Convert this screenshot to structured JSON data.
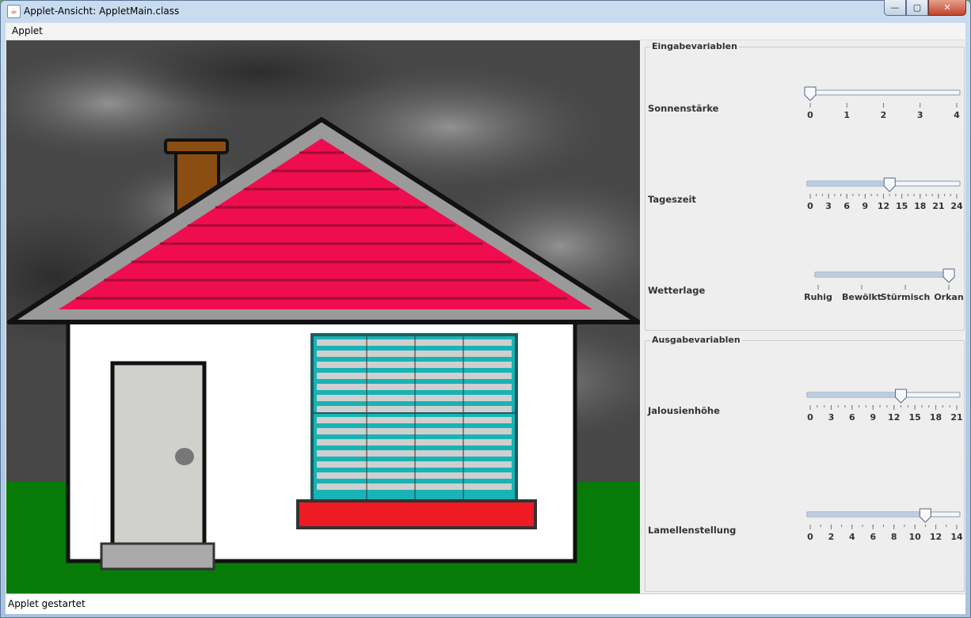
{
  "window": {
    "title": "Applet-Ansicht: AppletMain.class",
    "icon": "java-icon",
    "buttons": {
      "minimize": "—",
      "maximize": "▢",
      "close": "✕"
    }
  },
  "menu": {
    "applet": "Applet"
  },
  "scene": {
    "sky_color": "#474747",
    "grass_color": "#087a08",
    "roof_color": "#ef0d4f",
    "chimney_color": "#8b4e12",
    "wall_color": "#ffffff",
    "door_color": "#d0d0cd",
    "shutter_color": "#19b3b5",
    "sill_color": "#ee1b24"
  },
  "input_group": {
    "title": "Eingabevariablen",
    "sliders": [
      {
        "label": "Sonnenstärke",
        "min": 0,
        "max": 4,
        "value": 0,
        "major_ticks": [
          "0",
          "1",
          "2",
          "3",
          "4"
        ],
        "minor_count": 0
      },
      {
        "label": "Tageszeit",
        "min": 0,
        "max": 24,
        "value": 13,
        "major_ticks": [
          "0",
          "3",
          "6",
          "9",
          "12",
          "15",
          "18",
          "21",
          "24"
        ],
        "minor_count": 24
      },
      {
        "label": "Wetterlage",
        "min": 0,
        "max": 3,
        "value": 3,
        "major_ticks": [
          "Ruhig",
          "Bewölkt",
          "Stürmisch",
          "Orkan"
        ],
        "minor_count": 0
      }
    ]
  },
  "output_group": {
    "title": "Ausgabevariablen",
    "sliders": [
      {
        "label": "Jalousienhöhe",
        "min": 0,
        "max": 21,
        "value": 13,
        "major_ticks": [
          "0",
          "3",
          "6",
          "9",
          "12",
          "15",
          "18",
          "21"
        ],
        "minor_count": 21
      },
      {
        "label": "Lamellenstellung",
        "min": 0,
        "max": 14,
        "value": 11,
        "major_ticks": [
          "0",
          "2",
          "4",
          "6",
          "8",
          "10",
          "12",
          "14"
        ],
        "minor_count": 14
      }
    ]
  },
  "status": {
    "text": "Applet gestartet"
  }
}
